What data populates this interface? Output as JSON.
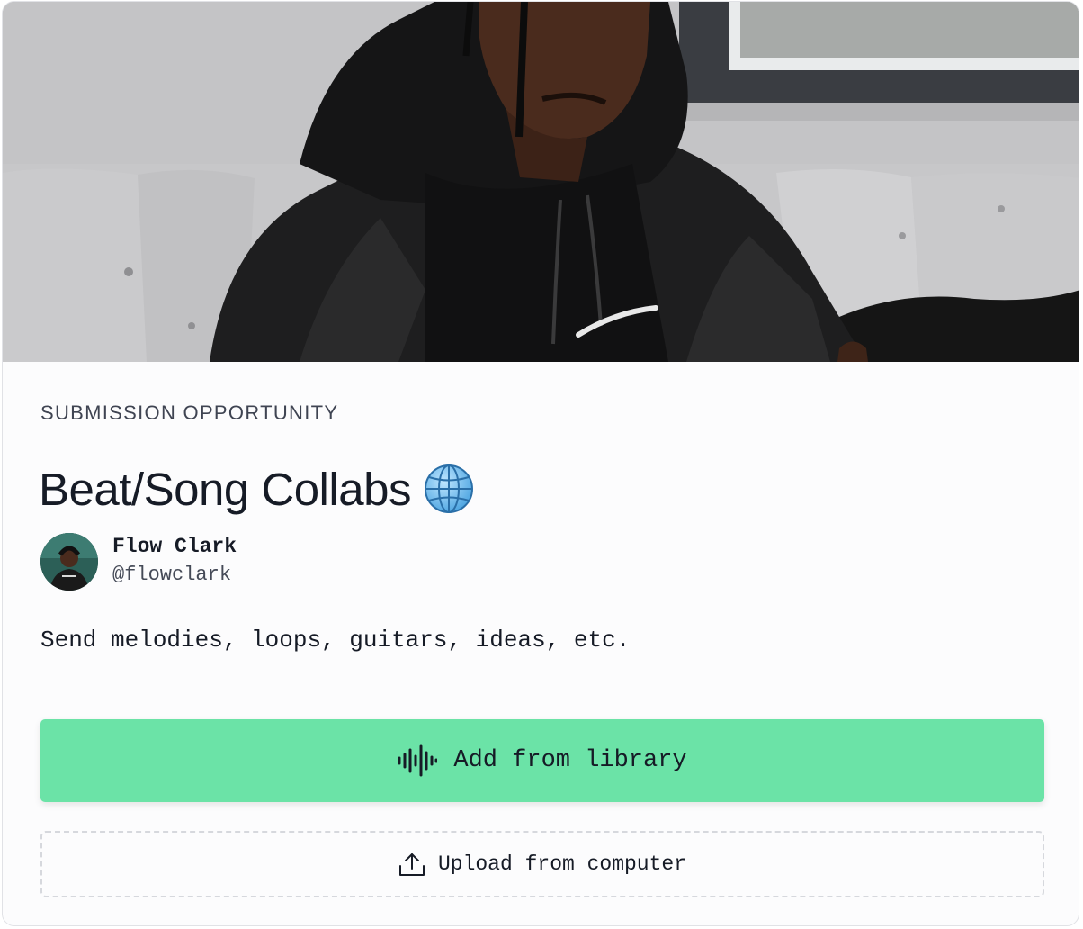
{
  "card": {
    "eyebrow": "SUBMISSION OPPORTUNITY",
    "title": "Beat/Song Collabs",
    "title_icon": "globe-icon",
    "author": {
      "name": "Flow Clark",
      "handle": "@flowclark"
    },
    "description": "Send melodies, loops, guitars, ideas, etc.",
    "primary_action": {
      "label": "Add from library",
      "icon": "waveform-icon",
      "color": "#6be3a7"
    },
    "secondary_action": {
      "label": "Upload from computer",
      "icon": "upload-icon"
    }
  },
  "colors": {
    "text": "#161b26",
    "muted": "#3f4452",
    "accent": "#6be3a7",
    "border": "#e1e2e6"
  }
}
